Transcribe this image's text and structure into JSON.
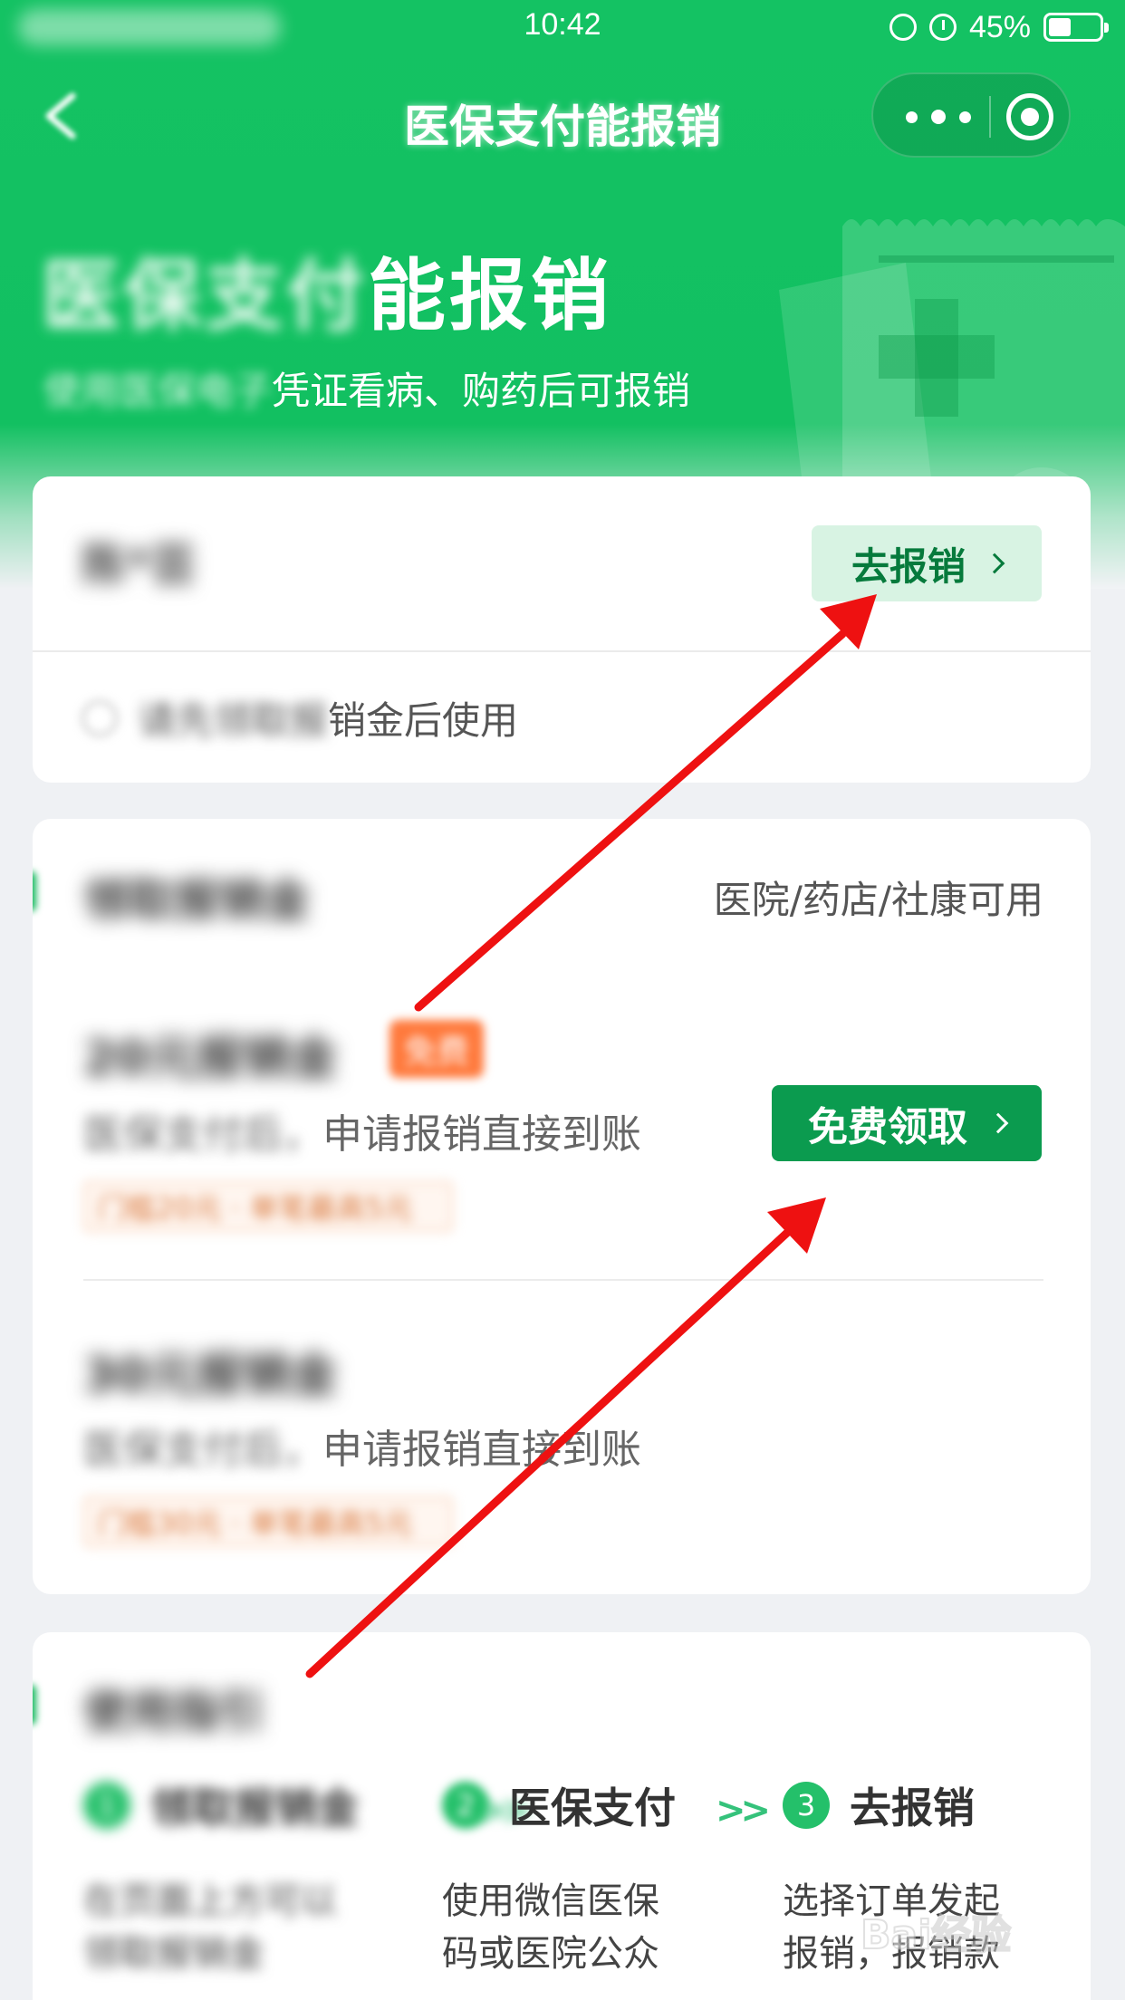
{
  "status_bar": {
    "time": "10:42",
    "battery_pct_label": "45%",
    "battery_level": 0.45
  },
  "nav": {
    "title": "医保支付能报销",
    "back_icon": "chevron-left-icon",
    "more_icon": "more-dots-icon",
    "close_icon": "target-circle-icon"
  },
  "hero": {
    "title_blurred": "医保支付",
    "title_clear": "能报销",
    "subtitle_blurred": "使用医保电子",
    "subtitle_clear": "凭证看病、购药后可报销",
    "art_icon": "medical-receipt-icon"
  },
  "account_card": {
    "name": "陈*芸",
    "reimburse_button": "去报销",
    "hint_blurred": "请先领取报",
    "hint_clear": "销金后使用"
  },
  "coupon_section": {
    "title": "领取报销金",
    "usable_note": "医院/药店/社康可用",
    "coupons": [
      {
        "title": "20元报销金",
        "badge": "免费",
        "desc_blurred": "医保支付后，",
        "desc_clear": "申请报销直接到账",
        "tag": "门槛20元 · 单笔最高5元",
        "button": "免费领取"
      },
      {
        "title": "30元报销金",
        "desc_blurred": "医保支付后，",
        "desc_clear": "申请报销直接到账",
        "tag": "门槛30元 · 单笔最高5元"
      }
    ]
  },
  "guide_section": {
    "title": "使用指引",
    "steps": [
      {
        "num": "1",
        "label": "领取报销金",
        "desc": [
          "在页面上方可以",
          "领取报销金"
        ]
      },
      {
        "num": "2",
        "label": "医保支付",
        "desc": [
          "使用微信医保",
          "码或医院公众"
        ]
      },
      {
        "num": "3",
        "label": "去报销",
        "desc": [
          "选择订单发起",
          "报销，报销款"
        ]
      }
    ],
    "step_arrow": ">>"
  },
  "watermark": {
    "text": "Bai经验"
  },
  "colors": {
    "brand_green": "#12c061",
    "button_green": "#0b9b4f",
    "reimburse_button_bg": "#d8f3e3",
    "badge_orange": "#ff7a3d",
    "annotation_red": "#ee1111",
    "page_bg": "#eff1f4"
  }
}
